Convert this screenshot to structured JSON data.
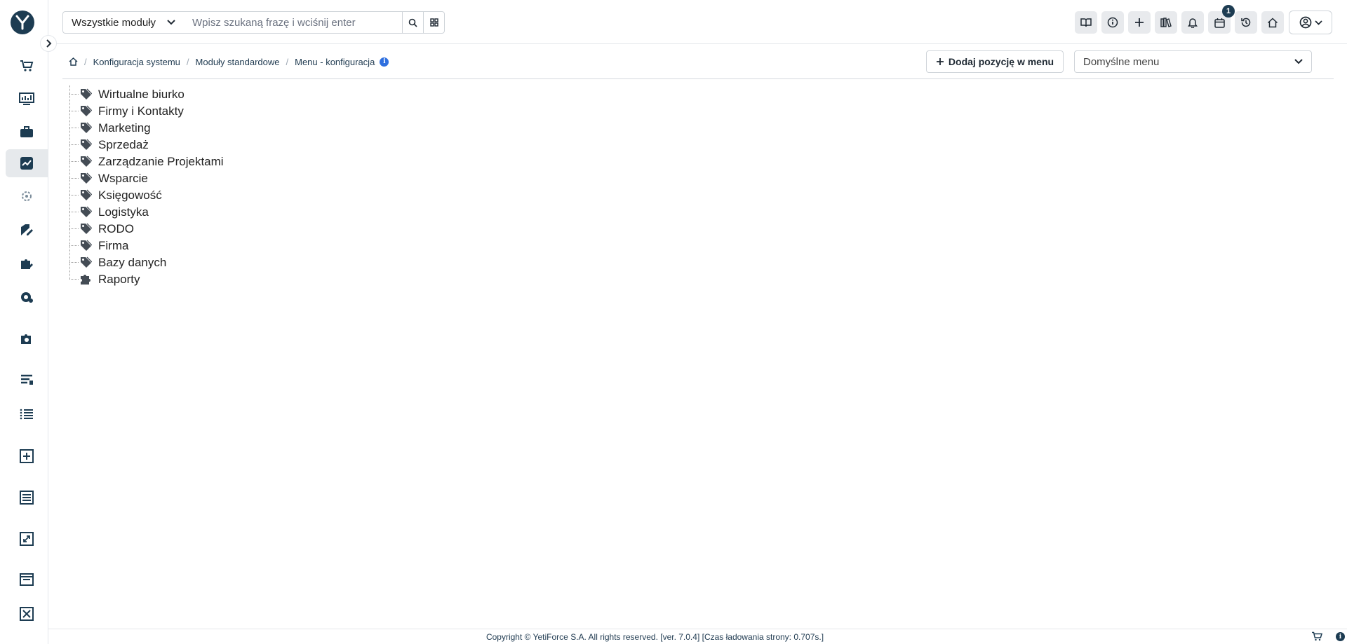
{
  "header": {
    "module_select": "Wszystkie moduły",
    "search_placeholder": "Wpisz szukaną frazę i wciśnij enter",
    "calendar_badge": "1"
  },
  "breadcrumb": {
    "items": [
      "Konfiguracja systemu",
      "Moduły standardowe",
      "Menu - konfiguracja"
    ]
  },
  "toolbar": {
    "add_label": "Dodaj pozycję w menu",
    "menu_select": "Domyślne menu"
  },
  "tree": {
    "items": [
      {
        "label": "Wirtualne biurko",
        "icon": "tag-icon"
      },
      {
        "label": "Firmy i Kontakty",
        "icon": "tag-icon"
      },
      {
        "label": "Marketing",
        "icon": "tag-icon"
      },
      {
        "label": "Sprzedaż",
        "icon": "tag-icon"
      },
      {
        "label": "Zarządzanie Projektami",
        "icon": "tag-icon"
      },
      {
        "label": "Wsparcie",
        "icon": "tag-icon"
      },
      {
        "label": "Księgowość",
        "icon": "tag-icon"
      },
      {
        "label": "Logistyka",
        "icon": "tag-icon"
      },
      {
        "label": "RODO",
        "icon": "tag-icon"
      },
      {
        "label": "Firma",
        "icon": "tag-icon"
      },
      {
        "label": "Bazy danych",
        "icon": "tag-icon"
      },
      {
        "label": "Raporty",
        "icon": "puzzle-icon"
      }
    ]
  },
  "footer": {
    "text": "Copyright © YetiForce S.A. All rights reserved. [ver. 7.0.4] [Czas ładowania strony: 0.707s.]"
  },
  "colors": {
    "brand": "#1d3c52",
    "info": "#2f6fdf"
  }
}
